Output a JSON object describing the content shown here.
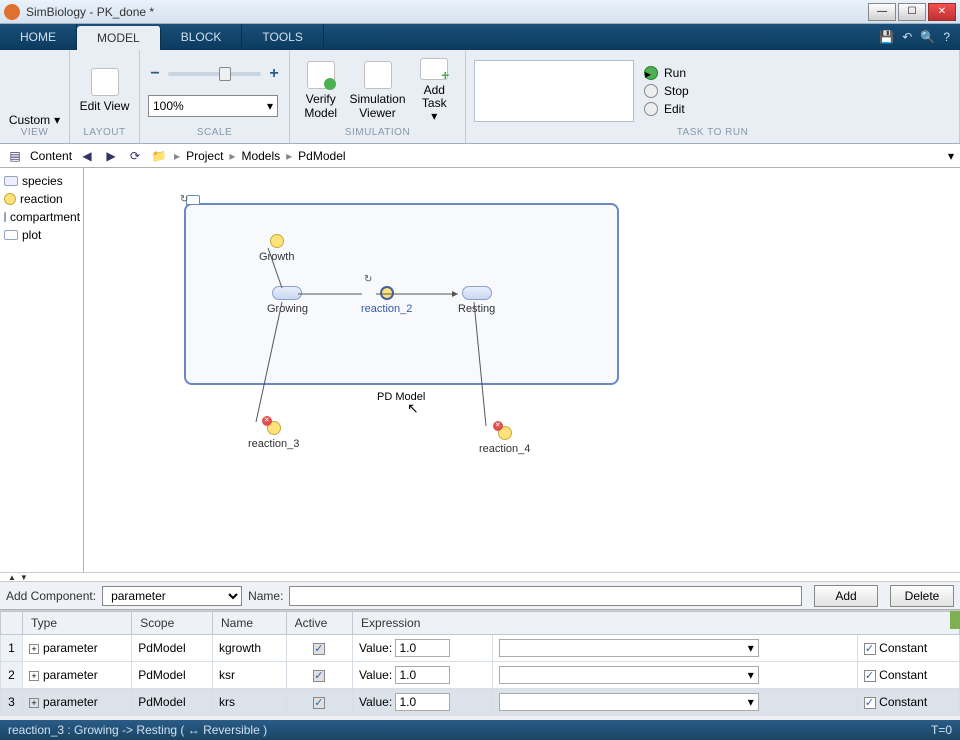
{
  "window": {
    "title": "SimBiology - PK_done *"
  },
  "tabs": {
    "home": "HOME",
    "model": "MODEL",
    "block": "BLOCK",
    "tools": "TOOLS"
  },
  "ribbon": {
    "view": {
      "custom": "Custom",
      "editview": "Edit View",
      "group": "VIEW"
    },
    "layout": {
      "group": "LAYOUT"
    },
    "scale": {
      "zoom": "100%",
      "group": "SCALE"
    },
    "simulation": {
      "verify": "Verify Model",
      "viewer": "Simulation Viewer",
      "addtask": "Add Task",
      "group": "SIMULATION"
    },
    "task": {
      "group": "TASK TO RUN",
      "run": "Run",
      "stop": "Stop",
      "edit": "Edit"
    }
  },
  "toolbar": {
    "content": "Content",
    "bc1": "Project",
    "bc2": "Models",
    "bc3": "PdModel"
  },
  "palette": {
    "species": "species",
    "reaction": "reaction",
    "compartment": "compartment",
    "plot": "plot"
  },
  "diagram": {
    "compartment_label": "PD Model",
    "growth": "Growth",
    "growing": "Growing",
    "reaction2": "reaction_2",
    "resting": "Resting",
    "reaction3": "reaction_3",
    "reaction4": "reaction_4"
  },
  "addrow": {
    "label": "Add Component:",
    "type": "parameter",
    "name_label": "Name:",
    "add": "Add",
    "delete": "Delete"
  },
  "table": {
    "headers": {
      "type": "Type",
      "scope": "Scope",
      "name": "Name",
      "active": "Active",
      "expression": "Expression"
    },
    "rows": [
      {
        "n": "1",
        "type": "parameter",
        "scope": "PdModel",
        "name": "kgrowth",
        "value_label": "Value:",
        "value": "1.0",
        "const": "Constant"
      },
      {
        "n": "2",
        "type": "parameter",
        "scope": "PdModel",
        "name": "ksr",
        "value_label": "Value:",
        "value": "1.0",
        "const": "Constant"
      },
      {
        "n": "3",
        "type": "parameter",
        "scope": "PdModel",
        "name": "krs",
        "value_label": "Value:",
        "value": "1.0",
        "const": "Constant"
      }
    ]
  },
  "status": {
    "left": "reaction_3 : Growing -> Resting ( ↔ Reversible )",
    "right": "T=0"
  }
}
